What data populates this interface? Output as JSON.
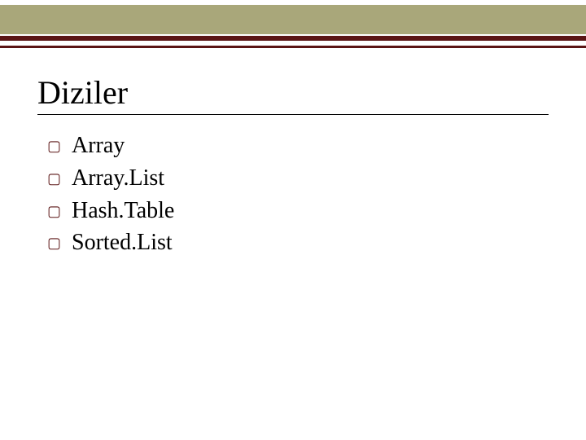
{
  "colors": {
    "band": "#a9a77a",
    "rule": "#5a1414",
    "bullet": "#5a1414"
  },
  "title": "Diziler",
  "bullets": [
    {
      "marker": "▢",
      "text": "Array"
    },
    {
      "marker": "▢",
      "text": "Array.List"
    },
    {
      "marker": "▢",
      "text": "Hash.Table"
    },
    {
      "marker": "▢",
      "text": "Sorted.List"
    }
  ]
}
